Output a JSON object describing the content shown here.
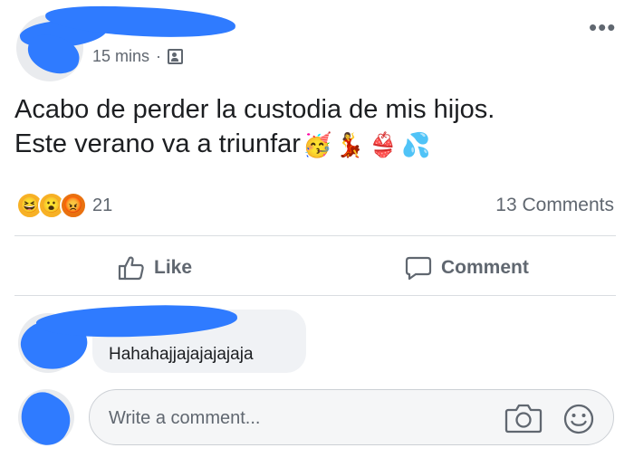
{
  "post": {
    "time": "15 mins",
    "separator": "·",
    "audience_icon": "friends-icon",
    "more_icon": "more-horizontal-icon",
    "more_glyph": "•••",
    "text_line1": "Acabo de perder la custodia de mis hijos.",
    "text_line2": "Este verano va a triunfar",
    "emojis": [
      "🥳",
      "💃",
      "👙",
      "💦"
    ]
  },
  "reactions": {
    "icons": [
      "😆",
      "😮",
      "😡"
    ],
    "names": [
      "haha-reaction-icon",
      "wow-reaction-icon",
      "angry-reaction-icon"
    ],
    "count": "21",
    "comments_count": "13 Comments"
  },
  "actions": {
    "like_label": "Like",
    "comment_label": "Comment"
  },
  "comment": {
    "text": "Hahahajjajajajajaja"
  },
  "composer": {
    "placeholder": "Write a comment..."
  },
  "colors": {
    "censor_blue": "#2f7bff",
    "text_primary": "#1c1e21",
    "text_secondary": "#606770",
    "bubble_bg": "#f0f2f5"
  }
}
